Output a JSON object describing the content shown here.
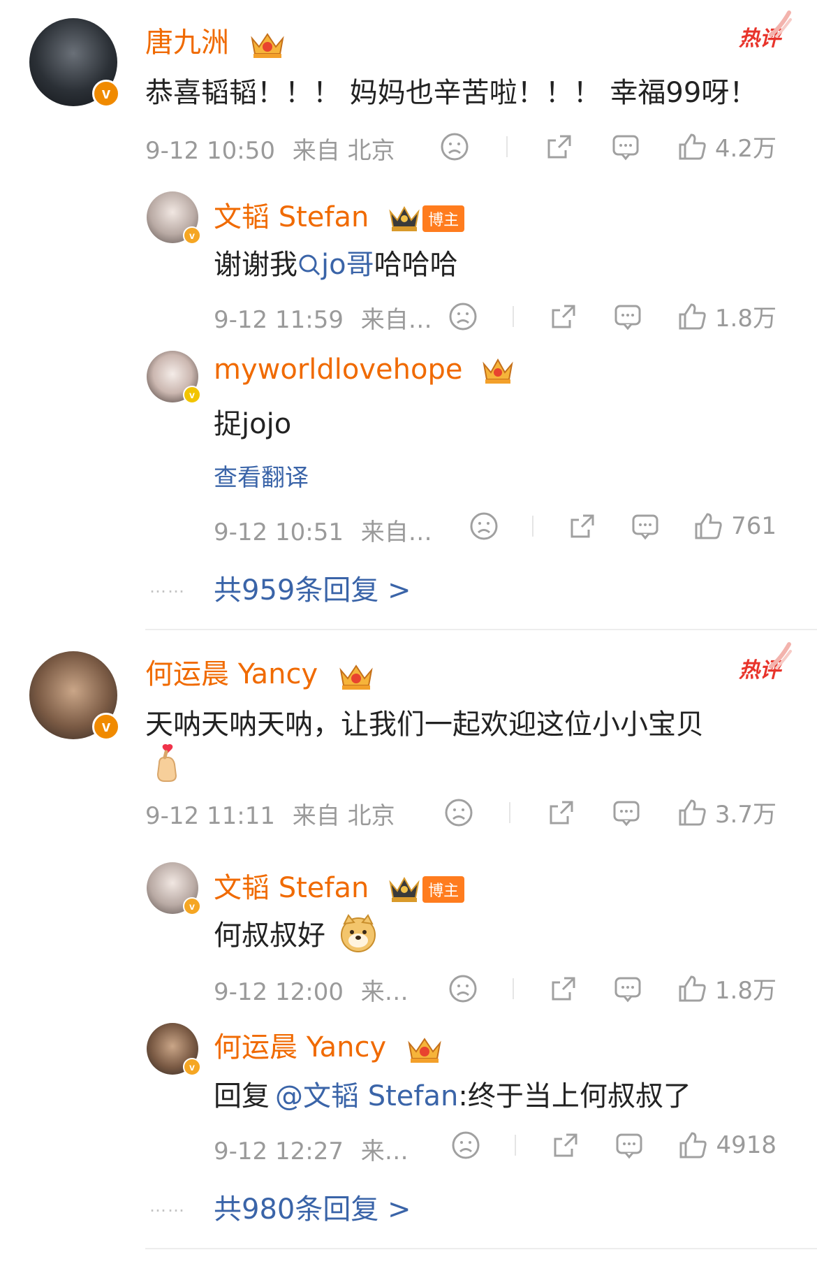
{
  "threads": [
    {
      "author": "唐九洲",
      "hot": "热评",
      "text": "恭喜韬韬！！！ 妈妈也辛苦啦！！！ 幸福99呀！",
      "time": "9-12 10:50",
      "source": "来自 北京",
      "likes": "4.2万",
      "replies": [
        {
          "author": "文韬 Stefan",
          "badge": "博主",
          "text_prefix": "谢谢我",
          "text_link": "jo哥",
          "text_suffix": "哈哈哈",
          "time": "9-12 11:59",
          "source": "来自…",
          "likes": "1.8万"
        },
        {
          "author": "myworldlovehope",
          "text": "捉jojo",
          "translate": "查看翻译",
          "time": "9-12 10:51",
          "source": "来自…",
          "likes": "761"
        }
      ],
      "more": "共959条回复 >"
    },
    {
      "author": "何运晨 Yancy",
      "hot": "热评",
      "text": "天呐天呐天呐，让我们一起欢迎这位小小宝贝",
      "time": "9-12 11:11",
      "source": "来自 北京",
      "likes": "3.7万",
      "replies": [
        {
          "author": "文韬 Stefan",
          "badge": "博主",
          "text": "何叔叔好",
          "time": "9-12 12:00",
          "source": "来…",
          "likes": "1.8万"
        },
        {
          "author": "何运晨 Yancy",
          "text_prefix": "回复",
          "text_link": "@文韬 Stefan",
          "text_suffix": ":终于当上何叔叔了",
          "time": "9-12 12:27",
          "source": "来…",
          "likes": "4918"
        }
      ],
      "more": "共980条回复 >"
    }
  ],
  "icons": {
    "verified": "v",
    "dots": "……"
  }
}
